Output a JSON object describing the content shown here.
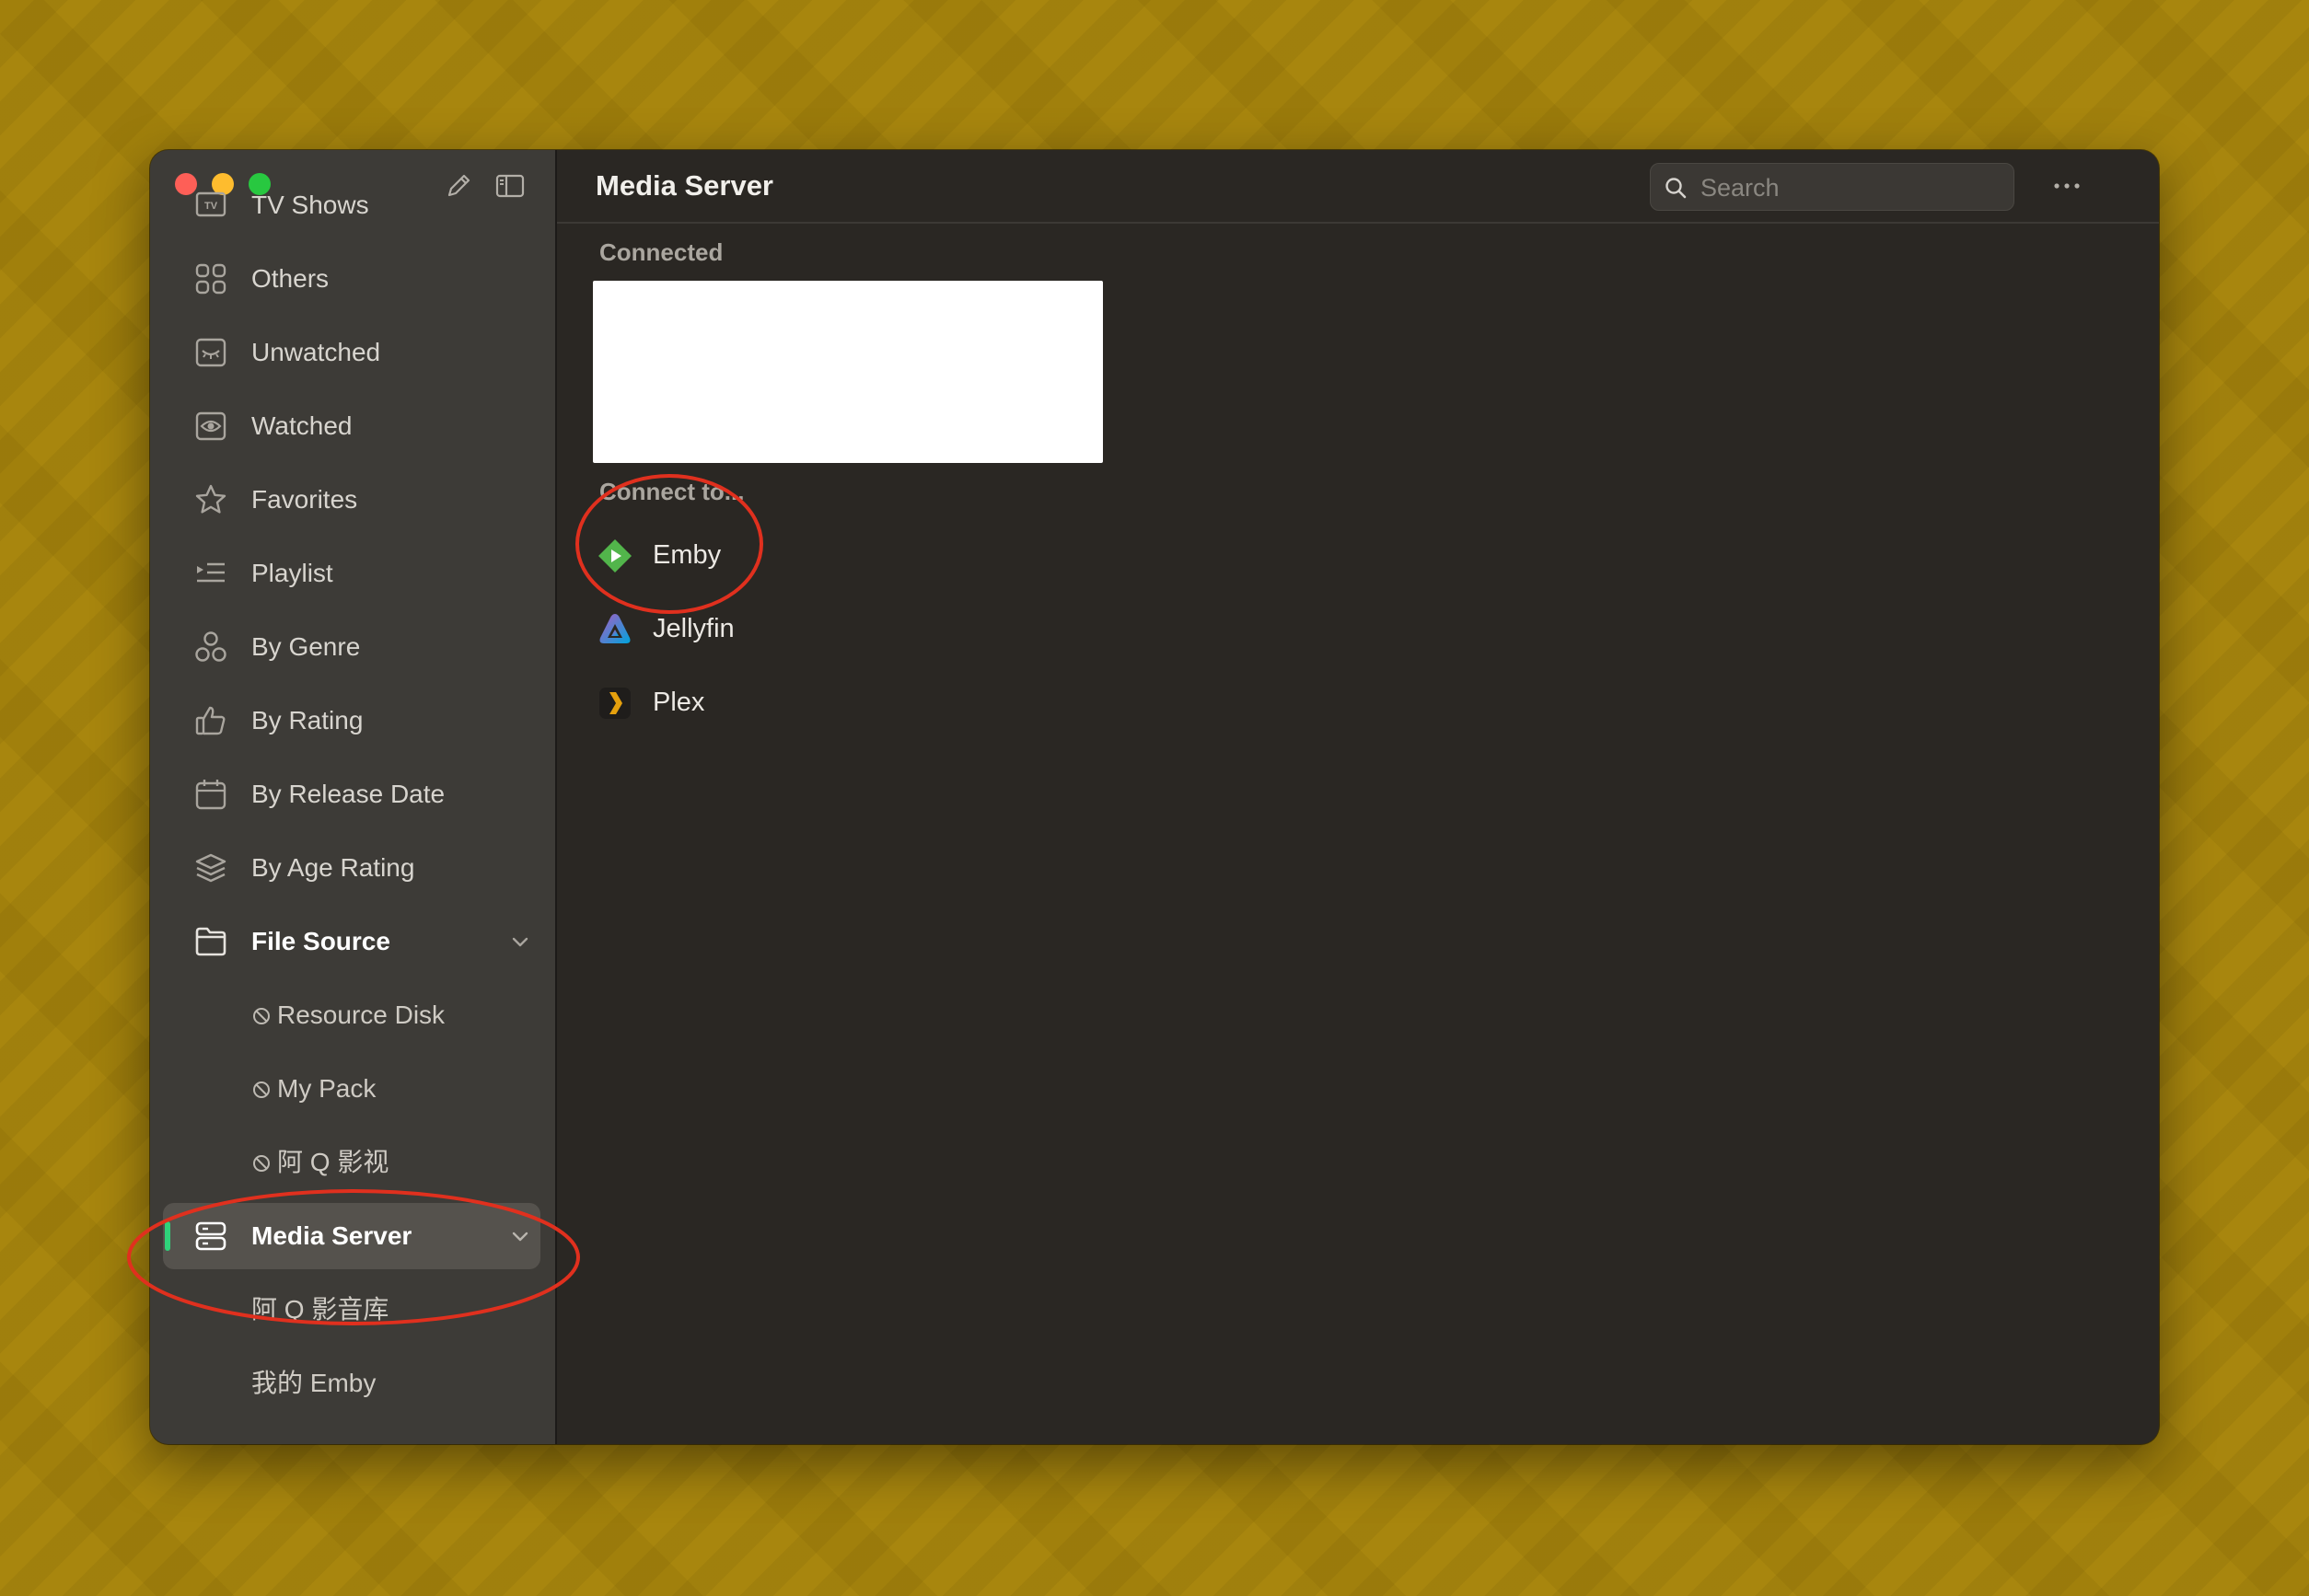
{
  "window": {
    "title": "Media Server"
  },
  "toolbar": {
    "search_placeholder": "Search",
    "more_icon": "ellipsis-icon",
    "edit_icon": "pencil-icon",
    "sidebar_toggle_icon": "sidebar-toggle-icon"
  },
  "sidebar": {
    "items": [
      {
        "label": "TV Shows",
        "icon": "tv-icon"
      },
      {
        "label": "Others",
        "icon": "grid-icon"
      },
      {
        "label": "Unwatched",
        "icon": "eye-closed-icon"
      },
      {
        "label": "Watched",
        "icon": "eye-icon"
      },
      {
        "label": "Favorites",
        "icon": "star-icon"
      },
      {
        "label": "Playlist",
        "icon": "playlist-icon"
      },
      {
        "label": "By Genre",
        "icon": "shapes-icon"
      },
      {
        "label": "By Rating",
        "icon": "thumbs-up-icon"
      },
      {
        "label": "By Release Date",
        "icon": "calendar-icon"
      },
      {
        "label": "By Age Rating",
        "icon": "layers-icon"
      }
    ],
    "file_source": {
      "label": "File Source",
      "icon": "folder-icon",
      "children": [
        "Resource Disk",
        "My Pack",
        "阿 Q 影视"
      ]
    },
    "media_server": {
      "label": "Media Server",
      "icon": "server-icon",
      "selected": true,
      "children": [
        "阿 Q 影音库",
        "我的 Emby"
      ]
    }
  },
  "main": {
    "connected_label": "Connected",
    "connect_to_label": "Connect to...",
    "servers": [
      {
        "label": "Emby",
        "icon": "emby-icon",
        "color": "#52b54b"
      },
      {
        "label": "Jellyfin",
        "icon": "jellyfin-icon",
        "color": "#aa5cc3"
      },
      {
        "label": "Plex",
        "icon": "plex-icon",
        "color": "#e5a00d"
      }
    ]
  },
  "colors": {
    "accent": "#2fd27a",
    "annotation": "#e0301e",
    "sidebar_bg": "#3d3b37",
    "main_bg": "#2a2723"
  }
}
